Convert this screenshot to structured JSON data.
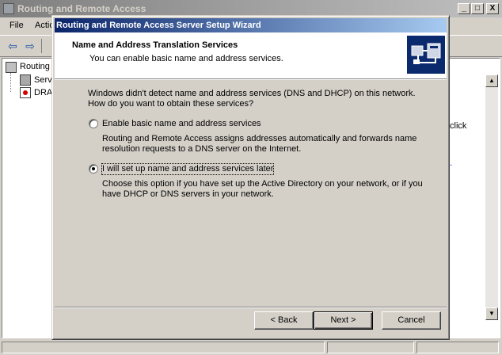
{
  "main_window": {
    "title": "Routing and Remote Access",
    "caption_buttons": {
      "minimize": "_",
      "maximize": "□",
      "close": "X"
    },
    "menu": [
      {
        "label": "File"
      },
      {
        "label": "Actio"
      }
    ],
    "toolbar": {
      "back_icon": "back-arrow-icon",
      "forward_icon": "forward-arrow-icon"
    },
    "tree": {
      "root": "Routing",
      "items": [
        "Serv",
        "DRA"
      ]
    },
    "result_pane": {
      "partial_text_1": "click",
      "partial_text_2": "e."
    }
  },
  "wizard": {
    "title": "Routing and Remote Access Server Setup Wizard",
    "header": {
      "title": "Name and Address Translation Services",
      "subtitle": "You can enable basic name and address services."
    },
    "intro_line1": "Windows didn't detect name and address services (DNS and DHCP) on this network.",
    "intro_line2": "How do you want to obtain these services?",
    "options": [
      {
        "label": "Enable basic name and address services",
        "selected": false,
        "desc_line1": "Routing and Remote Access assigns addresses automatically and forwards name",
        "desc_line2": "resolution requests to a DNS server on the Internet."
      },
      {
        "label": "I will set up name and address services later",
        "selected": true,
        "desc_line1": "Choose this option if you have set up the Active Directory on your network, or if you",
        "desc_line2": "have DHCP or DNS servers in your network."
      }
    ],
    "buttons": {
      "back": "< Back",
      "next": "Next >",
      "cancel": "Cancel"
    }
  }
}
